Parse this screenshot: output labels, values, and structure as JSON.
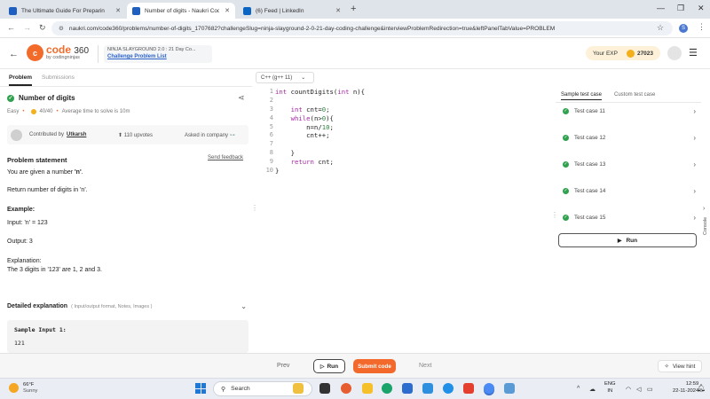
{
  "browser": {
    "tabs": [
      {
        "title": "The Ultimate Guide For Preparin",
        "active": false,
        "favicon_color": "#1f5fbf"
      },
      {
        "title": "Number of digits - Naukri Code",
        "active": true,
        "favicon_color": "#1f5fbf"
      },
      {
        "title": "(6) Feed | LinkedIn",
        "active": false,
        "favicon_color": "#0a66c2"
      }
    ],
    "new_tab": "+",
    "url": "naukri.com/code360/problems/number-of-digits_1707682?challengeSlug=ninja-slayground-2-0-21-day-coding-challenge&interviewProblemRedirection=true&leftPanelTabValue=PROBLEM",
    "profile_initial": "S"
  },
  "header": {
    "logo_main": "code",
    "logo_num": "360",
    "logo_sub": "by codingninjas",
    "slayground_title": "NINJA SLAYGROUND 2.0 : 21 Day Co...",
    "challenge_link": "Challenge Problem List",
    "exp_label": "Your EXP",
    "exp_value": "27023"
  },
  "left_panel": {
    "tabs": [
      "Problem",
      "Submissions"
    ],
    "title": "Number of digits",
    "difficulty": "Easy",
    "score": "40/40",
    "avg_time": "Average time to solve is 10m",
    "contributed_label": "Contributed by",
    "contributor": "Utkarsh",
    "upvotes": "110 upvotes",
    "asked_label": "Asked in company",
    "statement_heading": "Problem statement",
    "send_feedback": "Send feedback",
    "line1_pre": "You are given a number ",
    "line1_bold": "'n'",
    "line1_post": ".",
    "line2": "Return number of digits in 'n'.",
    "example_heading": "Example:",
    "input_line": "Input: 'n' = 123",
    "output_line": "Output: 3",
    "explanation_heading": "Explanation:",
    "explanation_text": "The 3 digits in '123' are 1, 2 and 3.",
    "detailed_heading": "Detailed explanation",
    "detailed_sub": "( Input/output format, Notes, Images )",
    "sample_heading": "Sample Input 1:",
    "sample_value": "121"
  },
  "editor": {
    "language": "C++ (g++ 11)",
    "line_numbers": [
      "1",
      "2",
      "3",
      "4",
      "5",
      "6",
      "7",
      "8",
      "9",
      "10"
    ]
  },
  "right_panel": {
    "tabs": [
      "Sample test case",
      "Custom test case"
    ],
    "test_cases": [
      "Test case 11",
      "Test case 12",
      "Test case 13",
      "Test case 14",
      "Test case 15"
    ],
    "run_label": "Run",
    "console_label": "Console"
  },
  "bottom_bar": {
    "prev": "Prev",
    "run": "Run",
    "submit": "Submit code",
    "next": "Next",
    "hint": "View hint"
  },
  "taskbar": {
    "temp": "66°F",
    "condition": "Sunny",
    "search_placeholder": "Search",
    "lang_line1": "ENG",
    "lang_line2": "IN",
    "time": "12:59",
    "date": "22-11-2024"
  },
  "colors": {
    "accent": "#f2692b",
    "success": "#30a14e",
    "link": "#2a62c9"
  }
}
